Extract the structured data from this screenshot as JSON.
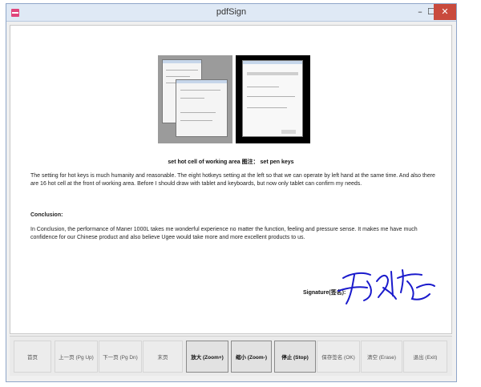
{
  "window": {
    "title": "pdfSign",
    "minimize_label": "–",
    "maximize_label": "☐",
    "close_label": "✕"
  },
  "document": {
    "figure_caption": "set hot cell of working area 图注： set pen keys",
    "paragraph1": "The setting for hot keys is much humanity and reasonable. The eight hotkeys setting at the left so that we can operate by left hand at the same time. And also there are 16 hot cell at the front of working area. Before I should draw with tablet and keyboards, but now only tablet can confirm my needs.",
    "conclusion_heading": "Conclusion:",
    "paragraph2": "In Conclusion, the performance of Maner 1000L takes me wonderful experience no matter the function, feeling and pressure sense. It makes me have much confidence for our Chinese product and also believe Ugee would take more and more excellent products to us.",
    "signature_label": "Signature(签名):"
  },
  "toolbar": {
    "buttons": [
      {
        "label": "首页",
        "active": false
      },
      {
        "label": "上一页 (Pg Up)",
        "active": false
      },
      {
        "label": "下一页 (Pg Dn)",
        "active": false
      },
      {
        "label": "末页",
        "active": false
      },
      {
        "label": "放大 (Zoom+)",
        "active": true
      },
      {
        "label": "缩小 (Zoom-)",
        "active": true
      },
      {
        "label": "停止 (Stop)",
        "active": true
      },
      {
        "label": "保存签名 (OK)",
        "active": false
      },
      {
        "label": "清空 (Erase)",
        "active": false
      },
      {
        "label": "退出 (Exit)",
        "active": false
      }
    ]
  },
  "colors": {
    "signature_ink": "#1a1acc",
    "close_button": "#c94a3d",
    "app_icon": "#e0457b"
  }
}
